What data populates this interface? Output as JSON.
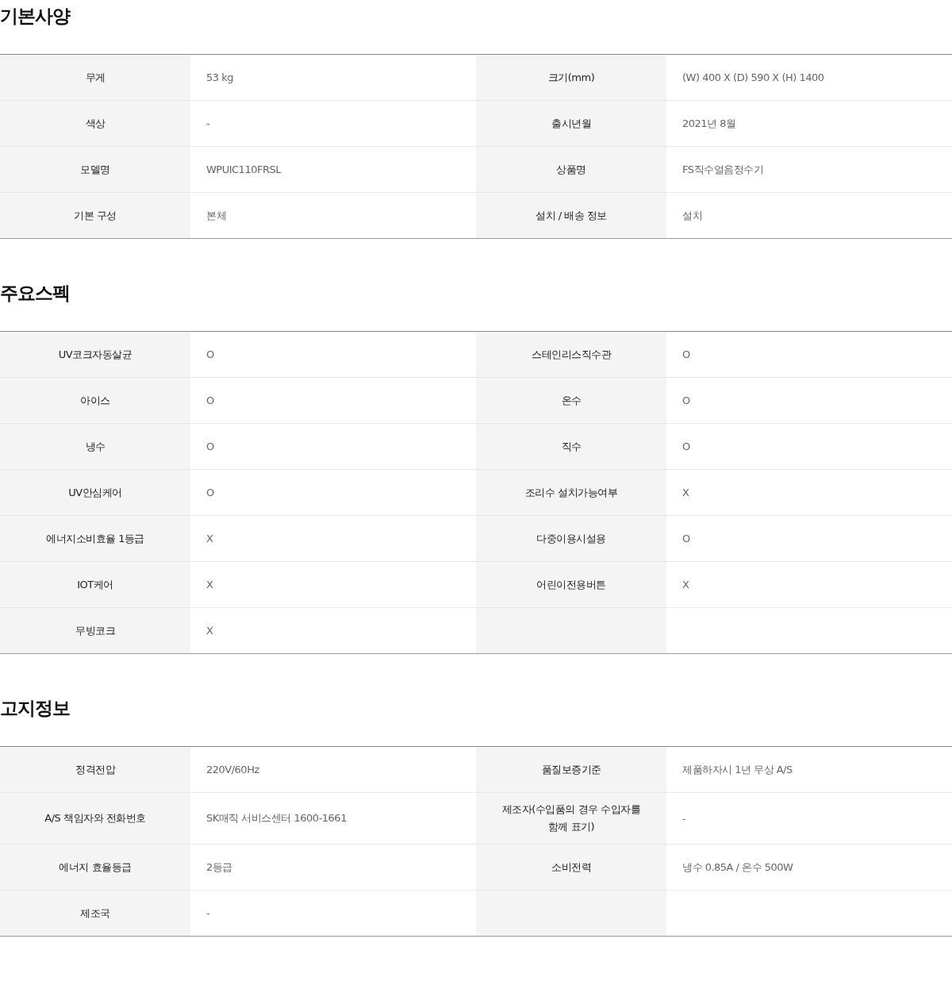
{
  "sections": [
    {
      "title": "기본사양",
      "rows": [
        [
          {
            "label": "무게",
            "value": "53 kg"
          },
          {
            "label": "크기(mm)",
            "value": "(W) 400 X (D) 590 X (H) 1400"
          }
        ],
        [
          {
            "label": "색상",
            "value": "-"
          },
          {
            "label": "출시년월",
            "value": "2021년 8월"
          }
        ],
        [
          {
            "label": "모델명",
            "value": "WPUIC110FRSL"
          },
          {
            "label": "상품명",
            "value": "FS직수얼음정수기"
          }
        ],
        [
          {
            "label": "기본 구성",
            "value": "본체"
          },
          {
            "label": "설치 / 배송 정보",
            "value": "설치"
          }
        ]
      ]
    },
    {
      "title": "주요스펙",
      "rows": [
        [
          {
            "label": "UV코크자동살균",
            "value": "O"
          },
          {
            "label": "스테인리스직수관",
            "value": "O"
          }
        ],
        [
          {
            "label": "아이스",
            "value": "O"
          },
          {
            "label": "온수",
            "value": "O"
          }
        ],
        [
          {
            "label": "냉수",
            "value": "O"
          },
          {
            "label": "직수",
            "value": "O"
          }
        ],
        [
          {
            "label": "UV안심케어",
            "value": "O"
          },
          {
            "label": "조리수 설치가능여부",
            "value": "X"
          }
        ],
        [
          {
            "label": "에너지소비효율 1등급",
            "value": "X"
          },
          {
            "label": "다중이용시설용",
            "value": "O"
          }
        ],
        [
          {
            "label": "IOT케어",
            "value": "X"
          },
          {
            "label": "어린이전용버튼",
            "value": "X"
          }
        ],
        [
          {
            "label": "무빙코크",
            "value": "X"
          }
        ]
      ]
    },
    {
      "title": "고지정보",
      "rows": [
        [
          {
            "label": "정격전압",
            "value": "220V/60Hz"
          },
          {
            "label": "품질보증기준",
            "value": "제품하자시 1년 무상 A/S"
          }
        ],
        [
          {
            "label": "A/S 책임자와 전화번호",
            "value": "SK매직 서비스센터 1600-1661"
          },
          {
            "label": "제조자(수입품의 경우 수입자를 함께 표기)",
            "value": "-"
          }
        ],
        [
          {
            "label": "에너지 효율등급",
            "value": "2등급"
          },
          {
            "label": "소비전력",
            "value": "냉수 0.85A / 온수 500W"
          }
        ],
        [
          {
            "label": "제조국",
            "value": "-"
          }
        ]
      ]
    }
  ]
}
